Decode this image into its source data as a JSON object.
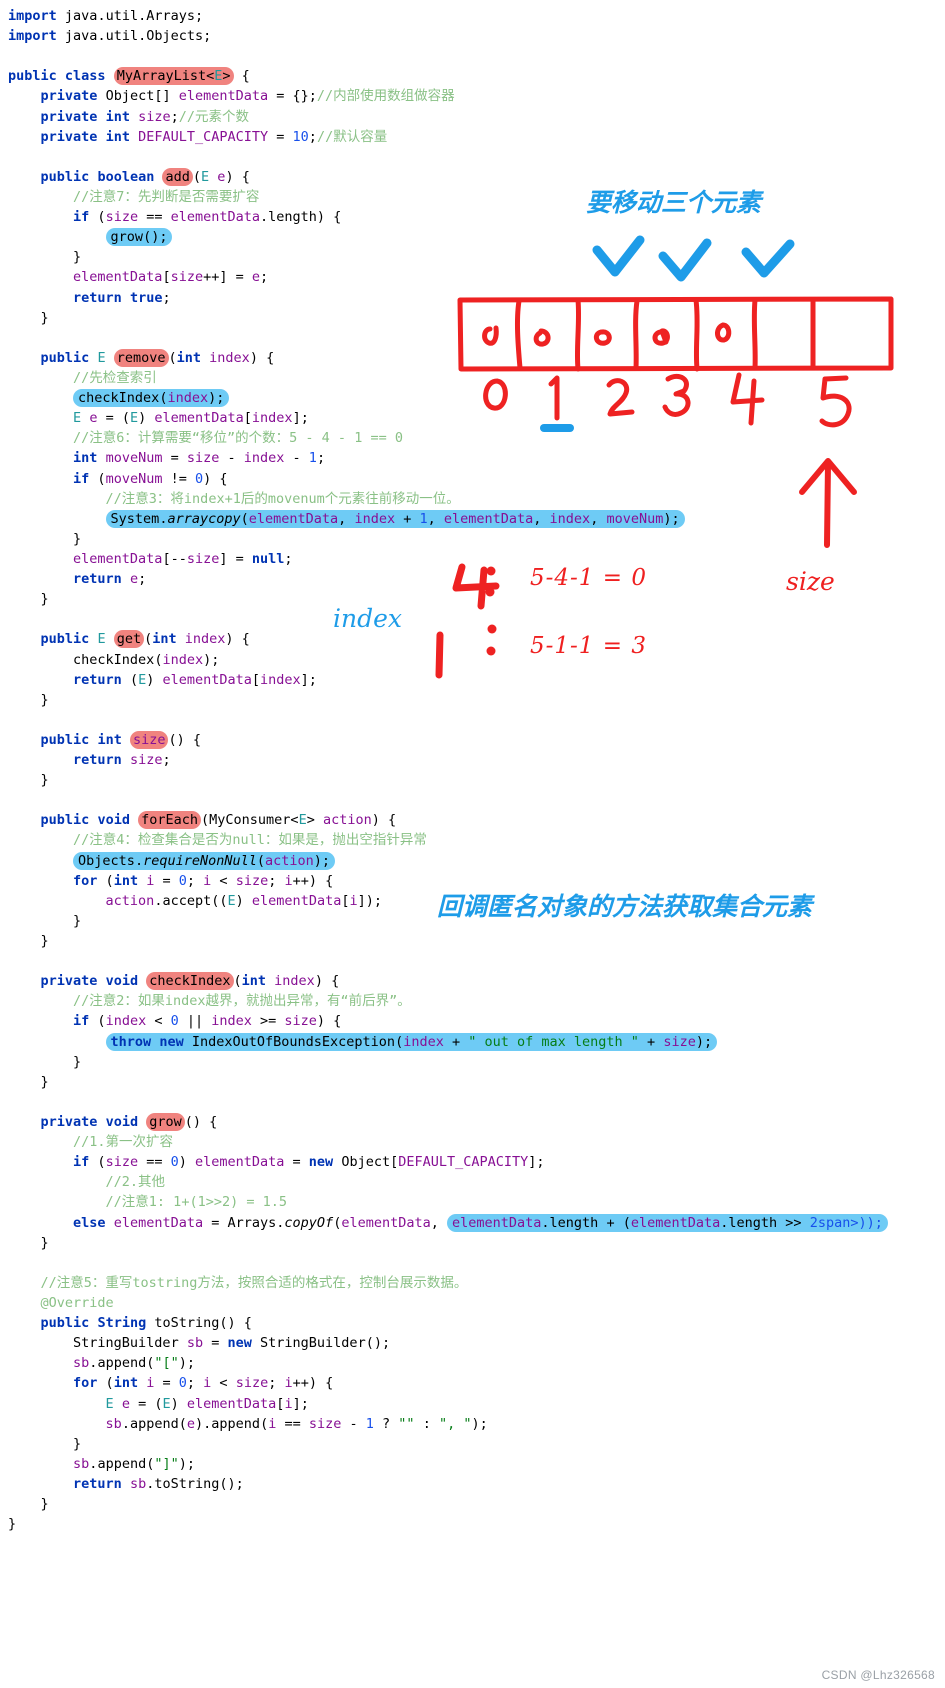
{
  "document": {
    "type": "java-source-with-handwritten-annotations",
    "filename_class": "MyArrayList"
  },
  "code": {
    "lines": [
      {
        "id": "l1",
        "text": "import java.util.Arrays;"
      },
      {
        "id": "l2",
        "text": "import java.util.Objects;"
      },
      {
        "id": "l3",
        "text": ""
      },
      {
        "id": "l4",
        "text": "public class MyArrayList<E> {"
      },
      {
        "id": "l5",
        "text": "    private Object[] elementData = {};//内部使用数组做容器"
      },
      {
        "id": "l6",
        "text": "    private int size;//元素个数"
      },
      {
        "id": "l7",
        "text": "    private int DEFAULT_CAPACITY = 10;//默认容量"
      },
      {
        "id": "l8",
        "text": ""
      },
      {
        "id": "l9",
        "text": "    public boolean add(E e) {"
      },
      {
        "id": "l10",
        "text": "        //注意7：先判断是否需要扩容"
      },
      {
        "id": "l11",
        "text": "        if (size == elementData.length) {"
      },
      {
        "id": "l12",
        "text": "            grow();"
      },
      {
        "id": "l13",
        "text": "        }"
      },
      {
        "id": "l14",
        "text": "        elementData[size++] = e;"
      },
      {
        "id": "l15",
        "text": "        return true;"
      },
      {
        "id": "l16",
        "text": "    }"
      },
      {
        "id": "l17",
        "text": ""
      },
      {
        "id": "l18",
        "text": "    public E remove(int index) {"
      },
      {
        "id": "l19",
        "text": "        //先检查索引"
      },
      {
        "id": "l20",
        "text": "        checkIndex(index);"
      },
      {
        "id": "l21",
        "text": "        E e = (E) elementData[index];"
      },
      {
        "id": "l22",
        "text": "        //注意6：计算需要“移位”的个数：5 - 4 - 1 == 0"
      },
      {
        "id": "l23",
        "text": "        int moveNum = size - index - 1;"
      },
      {
        "id": "l24",
        "text": "        if (moveNum != 0) {"
      },
      {
        "id": "l25",
        "text": "            //注意3：将index+1后的movenum个元素往前移动一位。"
      },
      {
        "id": "l26",
        "text": "            System.arraycopy(elementData, index + 1, elementData, index, moveNum);"
      },
      {
        "id": "l27",
        "text": "        }"
      },
      {
        "id": "l28",
        "text": "        elementData[--size] = null;"
      },
      {
        "id": "l29",
        "text": "        return e;"
      },
      {
        "id": "l30",
        "text": "    }"
      },
      {
        "id": "l31",
        "text": ""
      },
      {
        "id": "l32",
        "text": "    public E get(int index) {"
      },
      {
        "id": "l33",
        "text": "        checkIndex(index);"
      },
      {
        "id": "l34",
        "text": "        return (E) elementData[index];"
      },
      {
        "id": "l35",
        "text": "    }"
      },
      {
        "id": "l36",
        "text": ""
      },
      {
        "id": "l37",
        "text": "    public int size() {"
      },
      {
        "id": "l38",
        "text": "        return size;"
      },
      {
        "id": "l39",
        "text": "    }"
      },
      {
        "id": "l40",
        "text": ""
      },
      {
        "id": "l41",
        "text": "    public void forEach(MyConsumer<E> action) {"
      },
      {
        "id": "l42",
        "text": "        //注意4：检查集合是否为null：如果是，抛出空指针异常"
      },
      {
        "id": "l43",
        "text": "        Objects.requireNonNull(action);"
      },
      {
        "id": "l44",
        "text": "        for (int i = 0; i < size; i++) {"
      },
      {
        "id": "l45",
        "text": "            action.accept((E) elementData[i]);"
      },
      {
        "id": "l46",
        "text": "        }"
      },
      {
        "id": "l47",
        "text": "    }"
      },
      {
        "id": "l48",
        "text": ""
      },
      {
        "id": "l49",
        "text": "    private void checkIndex(int index) {"
      },
      {
        "id": "l50",
        "text": "        //注意2：如果index越界，就抛出异常，有“前后界”。"
      },
      {
        "id": "l51",
        "text": "        if (index < 0 || index >= size) {"
      },
      {
        "id": "l52",
        "text": "            throw new IndexOutOfBoundsException(index + \" out of max length \" + size);"
      },
      {
        "id": "l53",
        "text": "        }"
      },
      {
        "id": "l54",
        "text": "    }"
      },
      {
        "id": "l55",
        "text": ""
      },
      {
        "id": "l56",
        "text": "    private void grow() {"
      },
      {
        "id": "l57",
        "text": "        //1.第一次扩容"
      },
      {
        "id": "l58",
        "text": "        if (size == 0) elementData = new Object[DEFAULT_CAPACITY];"
      },
      {
        "id": "l59",
        "text": "            //2.其他"
      },
      {
        "id": "l60",
        "text": "            //注意1: 1+(1>>2) = 1.5"
      },
      {
        "id": "l61",
        "text": "        else elementData = Arrays.copyOf(elementData, elementData.length + (elementData.length >> 2));"
      },
      {
        "id": "l62",
        "text": "    }"
      },
      {
        "id": "l63",
        "text": ""
      },
      {
        "id": "l64",
        "text": "    //注意5：重写tostring方法，按照合适的格式在，控制台展示数据。"
      },
      {
        "id": "l65",
        "text": "    @Override"
      },
      {
        "id": "l66",
        "text": "    public String toString() {"
      },
      {
        "id": "l67",
        "text": "        StringBuilder sb = new StringBuilder();"
      },
      {
        "id": "l68",
        "text": "        sb.append(\"[\");"
      },
      {
        "id": "l69",
        "text": "        for (int i = 0; i < size; i++) {"
      },
      {
        "id": "l70",
        "text": "            E e = (E) elementData[i];"
      },
      {
        "id": "l71",
        "text": "            sb.append(e).append(i == size - 1 ? \"\" : \", \");"
      },
      {
        "id": "l72",
        "text": "        }"
      },
      {
        "id": "l73",
        "text": "        sb.append(\"]\");"
      },
      {
        "id": "l74",
        "text": "        return sb.toString();"
      },
      {
        "id": "l75",
        "text": "    }"
      },
      {
        "id": "l76",
        "text": "}"
      }
    ],
    "pink_highlights": [
      "MyArrayList<E>",
      "add",
      "remove",
      "get",
      "size",
      "forEach",
      "checkIndex",
      "grow"
    ],
    "blue_highlights": [
      "grow();",
      "checkIndex(index);",
      "System.arraycopy(elementData, index + 1, elementData, index, moveNum);",
      "Objects.requireNonNull(action);",
      "throw new IndexOutOfBoundsException(index + \" out of max length \" + size);",
      "elementData.length + (elementData.length >> 2)"
    ]
  },
  "annotations": {
    "title_note": "要移动三个元素",
    "check_marks_count": 3,
    "array_cells": [
      "o",
      "o",
      "o",
      "o",
      "o",
      ""
    ],
    "array_indices": [
      "0",
      "1",
      "2",
      "3",
      "4",
      "5"
    ],
    "underlined_index": "1",
    "size_arrow_label": "size",
    "index_label": "index",
    "calc_rows": [
      {
        "index_value": "4",
        "colon": ":",
        "expression": "5-4-1 = 0"
      },
      {
        "index_value": "1",
        "colon": ":",
        "expression": "5-1-1 = 3"
      }
    ],
    "callback_note": "回调匿名对象的方法获取集合元素"
  },
  "colors": {
    "handwriting_red": "#ef2020",
    "handwriting_blue": "#1e9ce8",
    "pink_highlight": "#f0837f",
    "blue_highlight": "#6ecbf5",
    "comment_green": "#8ac186",
    "keyword_blue": "#0033b3",
    "field_purple": "#871094",
    "string_green": "#067d17",
    "number_blue": "#1750eb"
  },
  "watermark": "CSDN @Lhz326568"
}
